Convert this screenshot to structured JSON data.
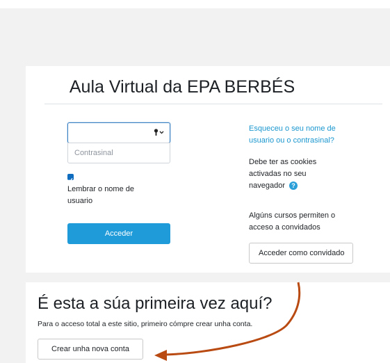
{
  "site_title": "Aula Virtual da EPA BERBÉS",
  "login": {
    "username_value": "",
    "password_placeholder": "Contrasinal",
    "remember_label_line1": "Lembrar o nome de",
    "remember_label_line2": "usuario",
    "remember_checked": true,
    "submit_label": "Acceder"
  },
  "side": {
    "forgot_line1": "Esqueceu o seu nome de",
    "forgot_line2": "usuario ou o contrasinal?",
    "cookies_line1": "Debe ter as cookies",
    "cookies_line2": "activadas no seu",
    "cookies_line3": "navegador",
    "help_icon": "?",
    "guests_line1": "Algúns cursos permiten o",
    "guests_line2": "acceso a convidados",
    "guest_button": "Acceder como convidado"
  },
  "signup": {
    "heading": "É esta a súa primeira vez aquí?",
    "text": "Para o acceso total a este sitio, primeiro cómpre crear unha conta.",
    "button": "Crear unha nova conta"
  },
  "colors": {
    "accent": "#1f9bd9",
    "link": "#1b97cf",
    "annotation_arrow": "#b84a12"
  }
}
